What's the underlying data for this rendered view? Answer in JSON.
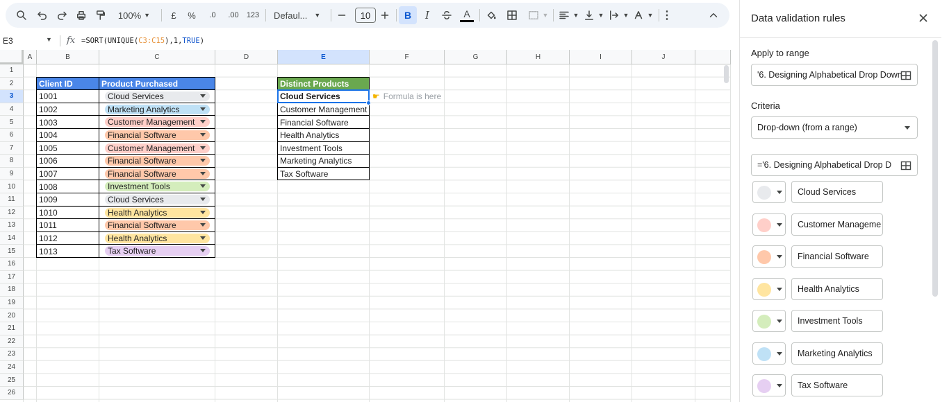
{
  "toolbar": {
    "zoom": "100%",
    "currency_symbol": "£",
    "percent_symbol": "%",
    "decimal_decrease": ".0",
    "decimal_increase": ".00",
    "number_format": "123",
    "font_family": "Defaul...",
    "font_size": "10",
    "bold_label": "B",
    "italic_label": "I",
    "text_color_label": "A"
  },
  "formula_bar": {
    "cell_ref": "E3",
    "fx": "fx",
    "formula_prefix": "=SORT(UNIQUE(",
    "formula_range": "C3:C15",
    "formula_mid": "),1,",
    "formula_bool": "TRUE",
    "formula_end": ")"
  },
  "grid": {
    "columns": [
      "A",
      "B",
      "C",
      "D",
      "E",
      "F",
      "G",
      "H",
      "I",
      "J"
    ],
    "rows": [
      "1",
      "2",
      "3",
      "4",
      "5",
      "6",
      "7",
      "8",
      "9",
      "10",
      "11",
      "12",
      "13",
      "14",
      "15",
      "16",
      "17",
      "18",
      "19",
      "20",
      "21",
      "22",
      "23",
      "24",
      "25",
      "26"
    ],
    "active_cell": "E3",
    "table1": {
      "header_client": "Client ID",
      "header_product": "Product Purchased",
      "header_color": "#4a86e8",
      "rows": [
        {
          "id": "1001",
          "product": "Cloud Services",
          "color": "#e8eaed"
        },
        {
          "id": "1002",
          "product": "Marketing Analytics",
          "color": "#bfe1f6"
        },
        {
          "id": "1003",
          "product": "Customer Management",
          "color": "#ffcfc9"
        },
        {
          "id": "1004",
          "product": "Financial Software",
          "color": "#ffc8aa"
        },
        {
          "id": "1005",
          "product": "Customer Management",
          "color": "#ffcfc9"
        },
        {
          "id": "1006",
          "product": "Financial Software",
          "color": "#ffc8aa"
        },
        {
          "id": "1007",
          "product": "Financial Software",
          "color": "#ffc8aa"
        },
        {
          "id": "1008",
          "product": "Investment Tools",
          "color": "#d4edbc"
        },
        {
          "id": "1009",
          "product": "Cloud Services",
          "color": "#e8eaed"
        },
        {
          "id": "1010",
          "product": "Health Analytics",
          "color": "#ffe5a0"
        },
        {
          "id": "1011",
          "product": "Financial Software",
          "color": "#ffc8aa"
        },
        {
          "id": "1012",
          "product": "Health Analytics",
          "color": "#ffe5a0"
        },
        {
          "id": "1013",
          "product": "Tax Software",
          "color": "#e6cff2"
        }
      ]
    },
    "table2": {
      "header": "Distinct Products",
      "header_color": "#6aa84f",
      "items": [
        "Cloud Services",
        "Customer Management",
        "Financial Software",
        "Health Analytics",
        "Investment Tools",
        "Marketing Analytics",
        "Tax Software"
      ]
    },
    "note": "Formula is here"
  },
  "panel": {
    "title": "Data validation rules",
    "apply_label": "Apply to range",
    "apply_value": "'6. Designing Alphabetical Drop Down",
    "criteria_label": "Criteria",
    "criteria_value": "Drop-down (from a range)",
    "range_value": "='6. Designing Alphabetical Drop D",
    "options": [
      {
        "label": "Cloud Services",
        "color": "#e8eaed"
      },
      {
        "label": "Customer Manageme",
        "color": "#ffcfc9"
      },
      {
        "label": "Financial Software",
        "color": "#ffc8aa"
      },
      {
        "label": "Health Analytics",
        "color": "#ffe5a0"
      },
      {
        "label": "Investment Tools",
        "color": "#d4edbc"
      },
      {
        "label": "Marketing Analytics",
        "color": "#bfe1f6"
      },
      {
        "label": "Tax Software",
        "color": "#e6cff2"
      }
    ]
  }
}
